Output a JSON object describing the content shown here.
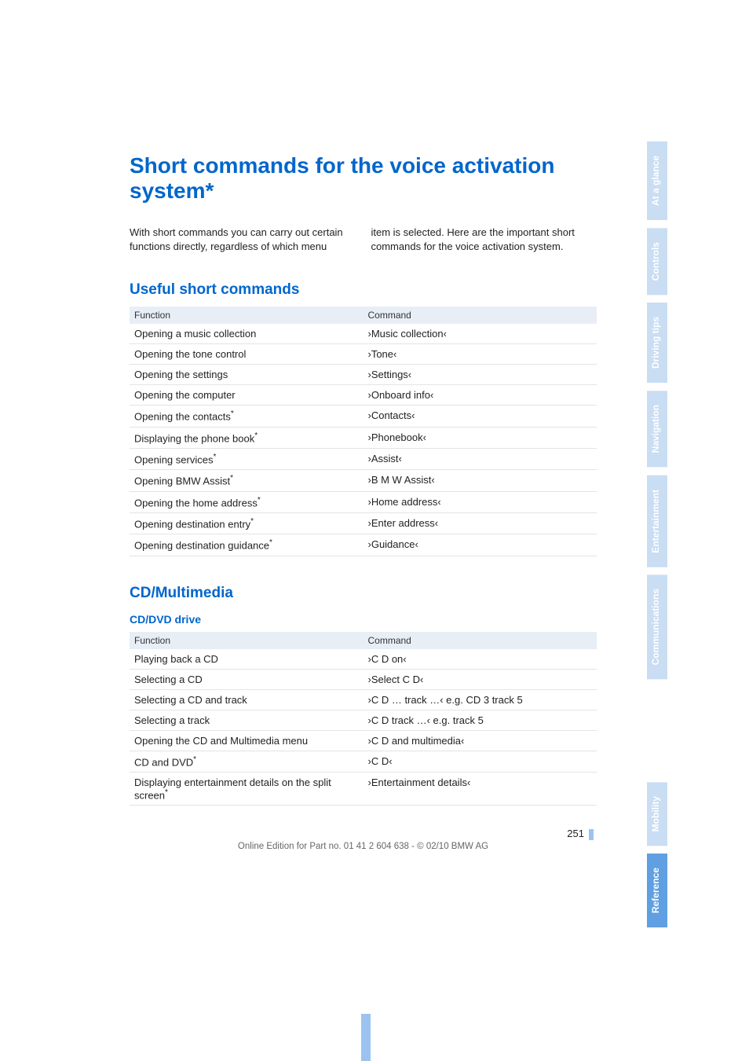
{
  "title": "Short commands for the voice activation system*",
  "intro_left": "With short commands you can carry out certain functions directly, regardless of which menu",
  "intro_right": "item is selected. Here are the important short commands for the voice activation system.",
  "section1": {
    "heading": "Useful short commands",
    "headers": {
      "fn": "Function",
      "cmd": "Command"
    },
    "rows": [
      {
        "fn": "Opening a music collection",
        "star": false,
        "cmd": "›Music collection‹"
      },
      {
        "fn": "Opening the tone control",
        "star": false,
        "cmd": "›Tone‹"
      },
      {
        "fn": "Opening the settings",
        "star": false,
        "cmd": "›Settings‹"
      },
      {
        "fn": "Opening the computer",
        "star": false,
        "cmd": "›Onboard info‹"
      },
      {
        "fn": "Opening the contacts",
        "star": true,
        "cmd": "›Contacts‹"
      },
      {
        "fn": "Displaying the phone book",
        "star": true,
        "cmd": "›Phonebook‹"
      },
      {
        "fn": "Opening services",
        "star": true,
        "cmd": "›Assist‹"
      },
      {
        "fn": "Opening BMW Assist",
        "star": true,
        "cmd": "›B M W Assist‹"
      },
      {
        "fn": "Opening the home address",
        "star": true,
        "cmd": "›Home address‹"
      },
      {
        "fn": "Opening destination entry",
        "star": true,
        "cmd": "›Enter address‹"
      },
      {
        "fn": "Opening destination guidance",
        "star": true,
        "cmd": "›Guidance‹"
      }
    ]
  },
  "section2": {
    "heading": "CD/Multimedia",
    "subheading": "CD/DVD drive",
    "headers": {
      "fn": "Function",
      "cmd": "Command"
    },
    "rows": [
      {
        "fn": "Playing back a CD",
        "star": false,
        "cmd": "›C D on‹"
      },
      {
        "fn": "Selecting a CD",
        "star": false,
        "cmd": "›Select C D‹"
      },
      {
        "fn": "Selecting a CD and track",
        "star": false,
        "cmd": "›C D … track …‹ e.g. CD 3 track 5"
      },
      {
        "fn": "Selecting a track",
        "star": false,
        "cmd": "›C D track …‹ e.g. track 5"
      },
      {
        "fn": "Opening the CD and Multimedia menu",
        "star": false,
        "cmd": "›C D and multimedia‹"
      },
      {
        "fn": "CD and DVD",
        "star": true,
        "cmd": "›C D‹"
      },
      {
        "fn": "Displaying entertainment details on the split screen",
        "star": true,
        "cmd": "›Entertainment details‹"
      }
    ]
  },
  "page_number": "251",
  "edition_line": "Online Edition for Part no. 01 41 2 604 638 - © 02/10 BMW AG",
  "tabs": {
    "at_a_glance": "At a glance",
    "controls": "Controls",
    "driving_tips": "Driving tips",
    "navigation": "Navigation",
    "entertainment": "Entertainment",
    "communications": "Communications",
    "mobility": "Mobility",
    "reference": "Reference"
  }
}
